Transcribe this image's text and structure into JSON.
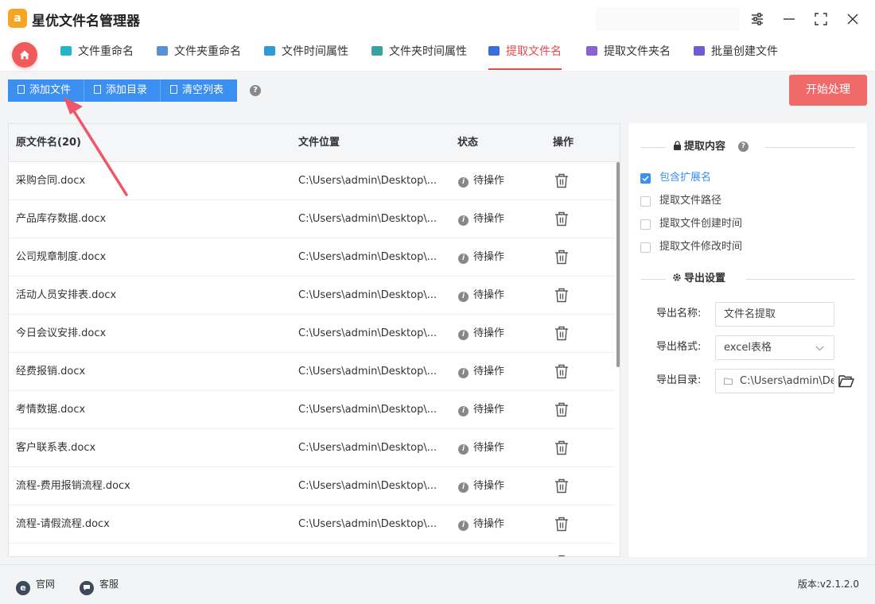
{
  "app": {
    "title": "星优文件名管理器",
    "logo_text": "a"
  },
  "tabs": [
    {
      "label": "文件重命名",
      "color": "#27b3c9"
    },
    {
      "label": "文件夹重命名",
      "color": "#5b8fd8"
    },
    {
      "label": "文件时间属性",
      "color": "#2f9ad6"
    },
    {
      "label": "文件夹时间属性",
      "color": "#3aa0a0"
    },
    {
      "label": "提取文件名",
      "color": "#3a6fd8",
      "active": true
    },
    {
      "label": "提取文件夹名",
      "color": "#8a63d2"
    },
    {
      "label": "批量创建文件",
      "color": "#6b5fd0"
    }
  ],
  "toolbar": {
    "add_file": "添加文件",
    "add_dir": "添加目录",
    "clear_list": "清空列表",
    "help": "?",
    "start": "开始处理"
  },
  "table": {
    "headers": [
      "原文件名(20)",
      "文件位置",
      "状态",
      "操作"
    ],
    "rows": [
      {
        "name": "采购合同.docx",
        "path": "C:\\Users\\admin\\Desktop\\...",
        "status": "待操作"
      },
      {
        "name": "产品库存数据.docx",
        "path": "C:\\Users\\admin\\Desktop\\...",
        "status": "待操作"
      },
      {
        "name": "公司规章制度.docx",
        "path": "C:\\Users\\admin\\Desktop\\...",
        "status": "待操作"
      },
      {
        "name": "活动人员安排表.docx",
        "path": "C:\\Users\\admin\\Desktop\\...",
        "status": "待操作"
      },
      {
        "name": "今日会议安排.docx",
        "path": "C:\\Users\\admin\\Desktop\\...",
        "status": "待操作"
      },
      {
        "name": "经费报销.docx",
        "path": "C:\\Users\\admin\\Desktop\\...",
        "status": "待操作"
      },
      {
        "name": "考情数据.docx",
        "path": "C:\\Users\\admin\\Desktop\\...",
        "status": "待操作"
      },
      {
        "name": "客户联系表.docx",
        "path": "C:\\Users\\admin\\Desktop\\...",
        "status": "待操作"
      },
      {
        "name": "流程-费用报销流程.docx",
        "path": "C:\\Users\\admin\\Desktop\\...",
        "status": "待操作"
      },
      {
        "name": "流程-请假流程.docx",
        "path": "C:\\Users\\admin\\Desktop\\...",
        "status": "待操作"
      }
    ]
  },
  "panel": {
    "extract_title": "提取内容",
    "options": [
      {
        "label": "包含扩展名",
        "checked": true
      },
      {
        "label": "提取文件路径",
        "checked": false
      },
      {
        "label": "提取文件创建时间",
        "checked": false
      },
      {
        "label": "提取文件修改时间",
        "checked": false
      }
    ],
    "export_title": "导出设置",
    "export_name_label": "导出名称:",
    "export_name_value": "文件名提取",
    "export_format_label": "导出格式:",
    "export_format_value": "excel表格",
    "export_dir_label": "导出目录:",
    "export_dir_value": "C:\\Users\\admin\\Des"
  },
  "footer": {
    "website": "官网",
    "website_icon": "e",
    "support": "客服",
    "version": "版本:v2.1.2.0"
  },
  "colors": {
    "accent_blue": "#3a8ff0",
    "accent_red": "#f06a6a",
    "active_tab": "#e5484d"
  }
}
